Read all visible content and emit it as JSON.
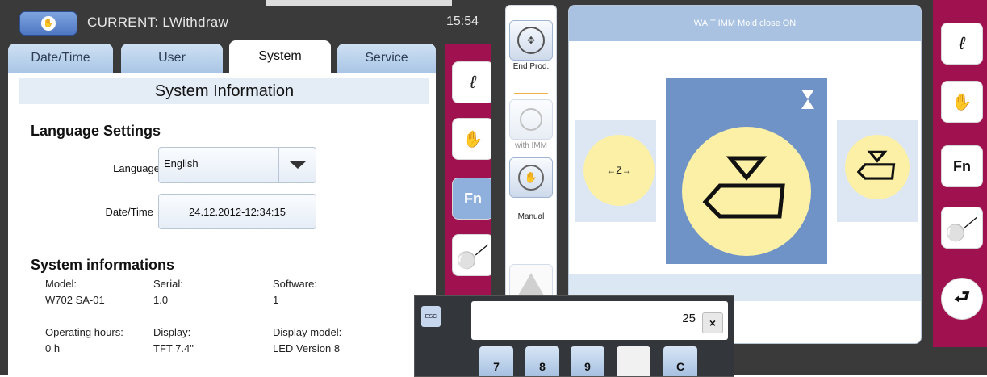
{
  "left_screen": {
    "current_label": "CURRENT: LWithdraw",
    "clock": "15:54",
    "tabs": [
      {
        "label": "Date/Time"
      },
      {
        "label": "User"
      },
      {
        "label": "System"
      },
      {
        "label": "Service"
      }
    ],
    "active_tab": "System",
    "section_title": "System Information",
    "language_settings": {
      "heading": "Language Settings",
      "language_label": "Language",
      "language_value": "English",
      "datetime_label": "Date/Time",
      "datetime_value": "24.12.2012-12:34:15"
    },
    "system_info": {
      "heading": "System informations",
      "fields": [
        {
          "label": "Model:",
          "value": "W702 SA-01"
        },
        {
          "label": "Serial:",
          "value": "1.0"
        },
        {
          "label": "Software:",
          "value": "1"
        },
        {
          "label": "Operating hours:",
          "value": "0 h"
        },
        {
          "label": "Display:",
          "value": "TFT 7.4\""
        },
        {
          "label": "Display model:",
          "value": "LED Version 8"
        }
      ]
    },
    "side_buttons": [
      {
        "icon": "pencil-icon",
        "label": ""
      },
      {
        "icon": "hand-icon",
        "label": ""
      },
      {
        "icon": "function-icon",
        "label": "Fn"
      },
      {
        "icon": "key-icon",
        "label": ""
      }
    ]
  },
  "right_screen": {
    "left_column": [
      {
        "icon": "move-arrows-icon",
        "label": "End Prod."
      },
      {
        "icon": "cycle-icon",
        "label": "with IMM"
      },
      {
        "icon": "hand-icon",
        "label": "Manual"
      },
      {
        "icon": "warning-icon",
        "label": ""
      }
    ],
    "status_message": "WAIT IMM Mold close ON",
    "side_step_label": "←Z→",
    "side_buttons": [
      {
        "icon": "pencil-icon",
        "label": ""
      },
      {
        "icon": "hand-icon",
        "label": ""
      },
      {
        "icon": "function-icon",
        "label": "Fn"
      },
      {
        "icon": "key-icon",
        "label": ""
      },
      {
        "icon": "return-icon",
        "label": ""
      }
    ]
  },
  "keypad": {
    "esc_label": "ESC",
    "display_value": "25",
    "clear_label": "×",
    "keys": [
      {
        "label": "7"
      },
      {
        "label": "8"
      },
      {
        "label": "9"
      },
      {
        "label": ""
      },
      {
        "label": "C"
      }
    ]
  },
  "colors": {
    "accent_magenta": "#a0124f",
    "tab_blue": "#a9c6e6",
    "step_yellow": "#fbf0a6",
    "step_blue": "#6f93c7"
  }
}
